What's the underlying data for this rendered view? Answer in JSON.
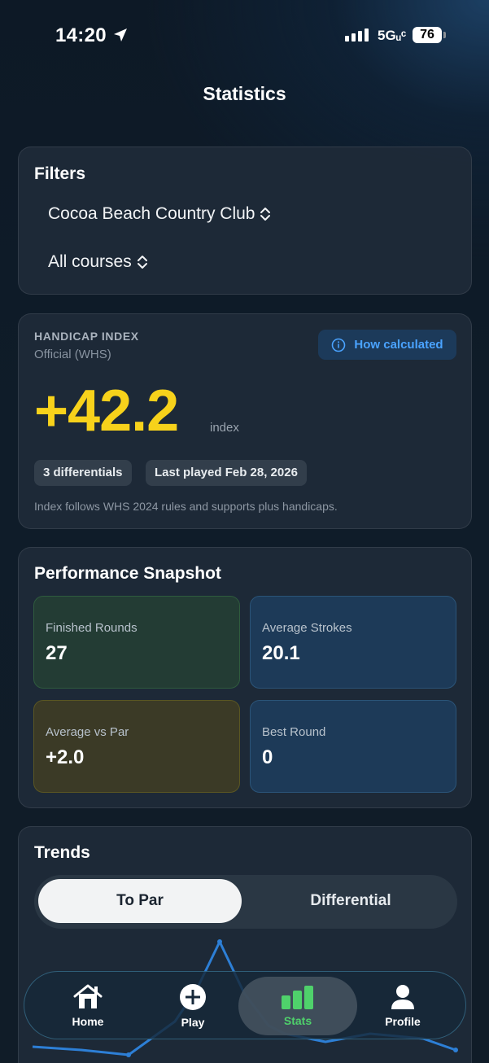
{
  "status_bar": {
    "time": "14:20",
    "network": "5Gᵤᶜ",
    "battery": "76"
  },
  "page_title": "Statistics",
  "filters": {
    "title": "Filters",
    "club": "Cocoa Beach Country Club",
    "course": "All courses"
  },
  "handicap": {
    "label": "HANDICAP INDEX",
    "subtitle": "Official (WHS)",
    "how_button": "How calculated",
    "value": "+42.2",
    "unit": "index",
    "chip_differentials": "3 differentials",
    "chip_last_played": "Last played Feb 28, 2026",
    "note": "Index follows WHS 2024 rules and supports plus handicaps."
  },
  "performance": {
    "title": "Performance Snapshot",
    "stats": [
      {
        "label": "Finished Rounds",
        "value": "27"
      },
      {
        "label": "Average Strokes",
        "value": "20.1"
      },
      {
        "label": "Average vs Par",
        "value": "+2.0"
      },
      {
        "label": "Best Round",
        "value": "0"
      }
    ]
  },
  "trends": {
    "title": "Trends",
    "segments": [
      "To Par",
      "Differential"
    ],
    "selected": "To Par"
  },
  "tabbar": {
    "items": [
      {
        "label": "Home",
        "icon": "home-icon"
      },
      {
        "label": "Play",
        "icon": "plus-circle-icon"
      },
      {
        "label": "Stats",
        "icon": "bar-chart-icon"
      },
      {
        "label": "Profile",
        "icon": "person-icon"
      }
    ],
    "selected": "Stats"
  },
  "colors": {
    "accent_yellow": "#f7d21b",
    "accent_blue": "#4aa3ff",
    "accent_green": "#4fd16b"
  }
}
